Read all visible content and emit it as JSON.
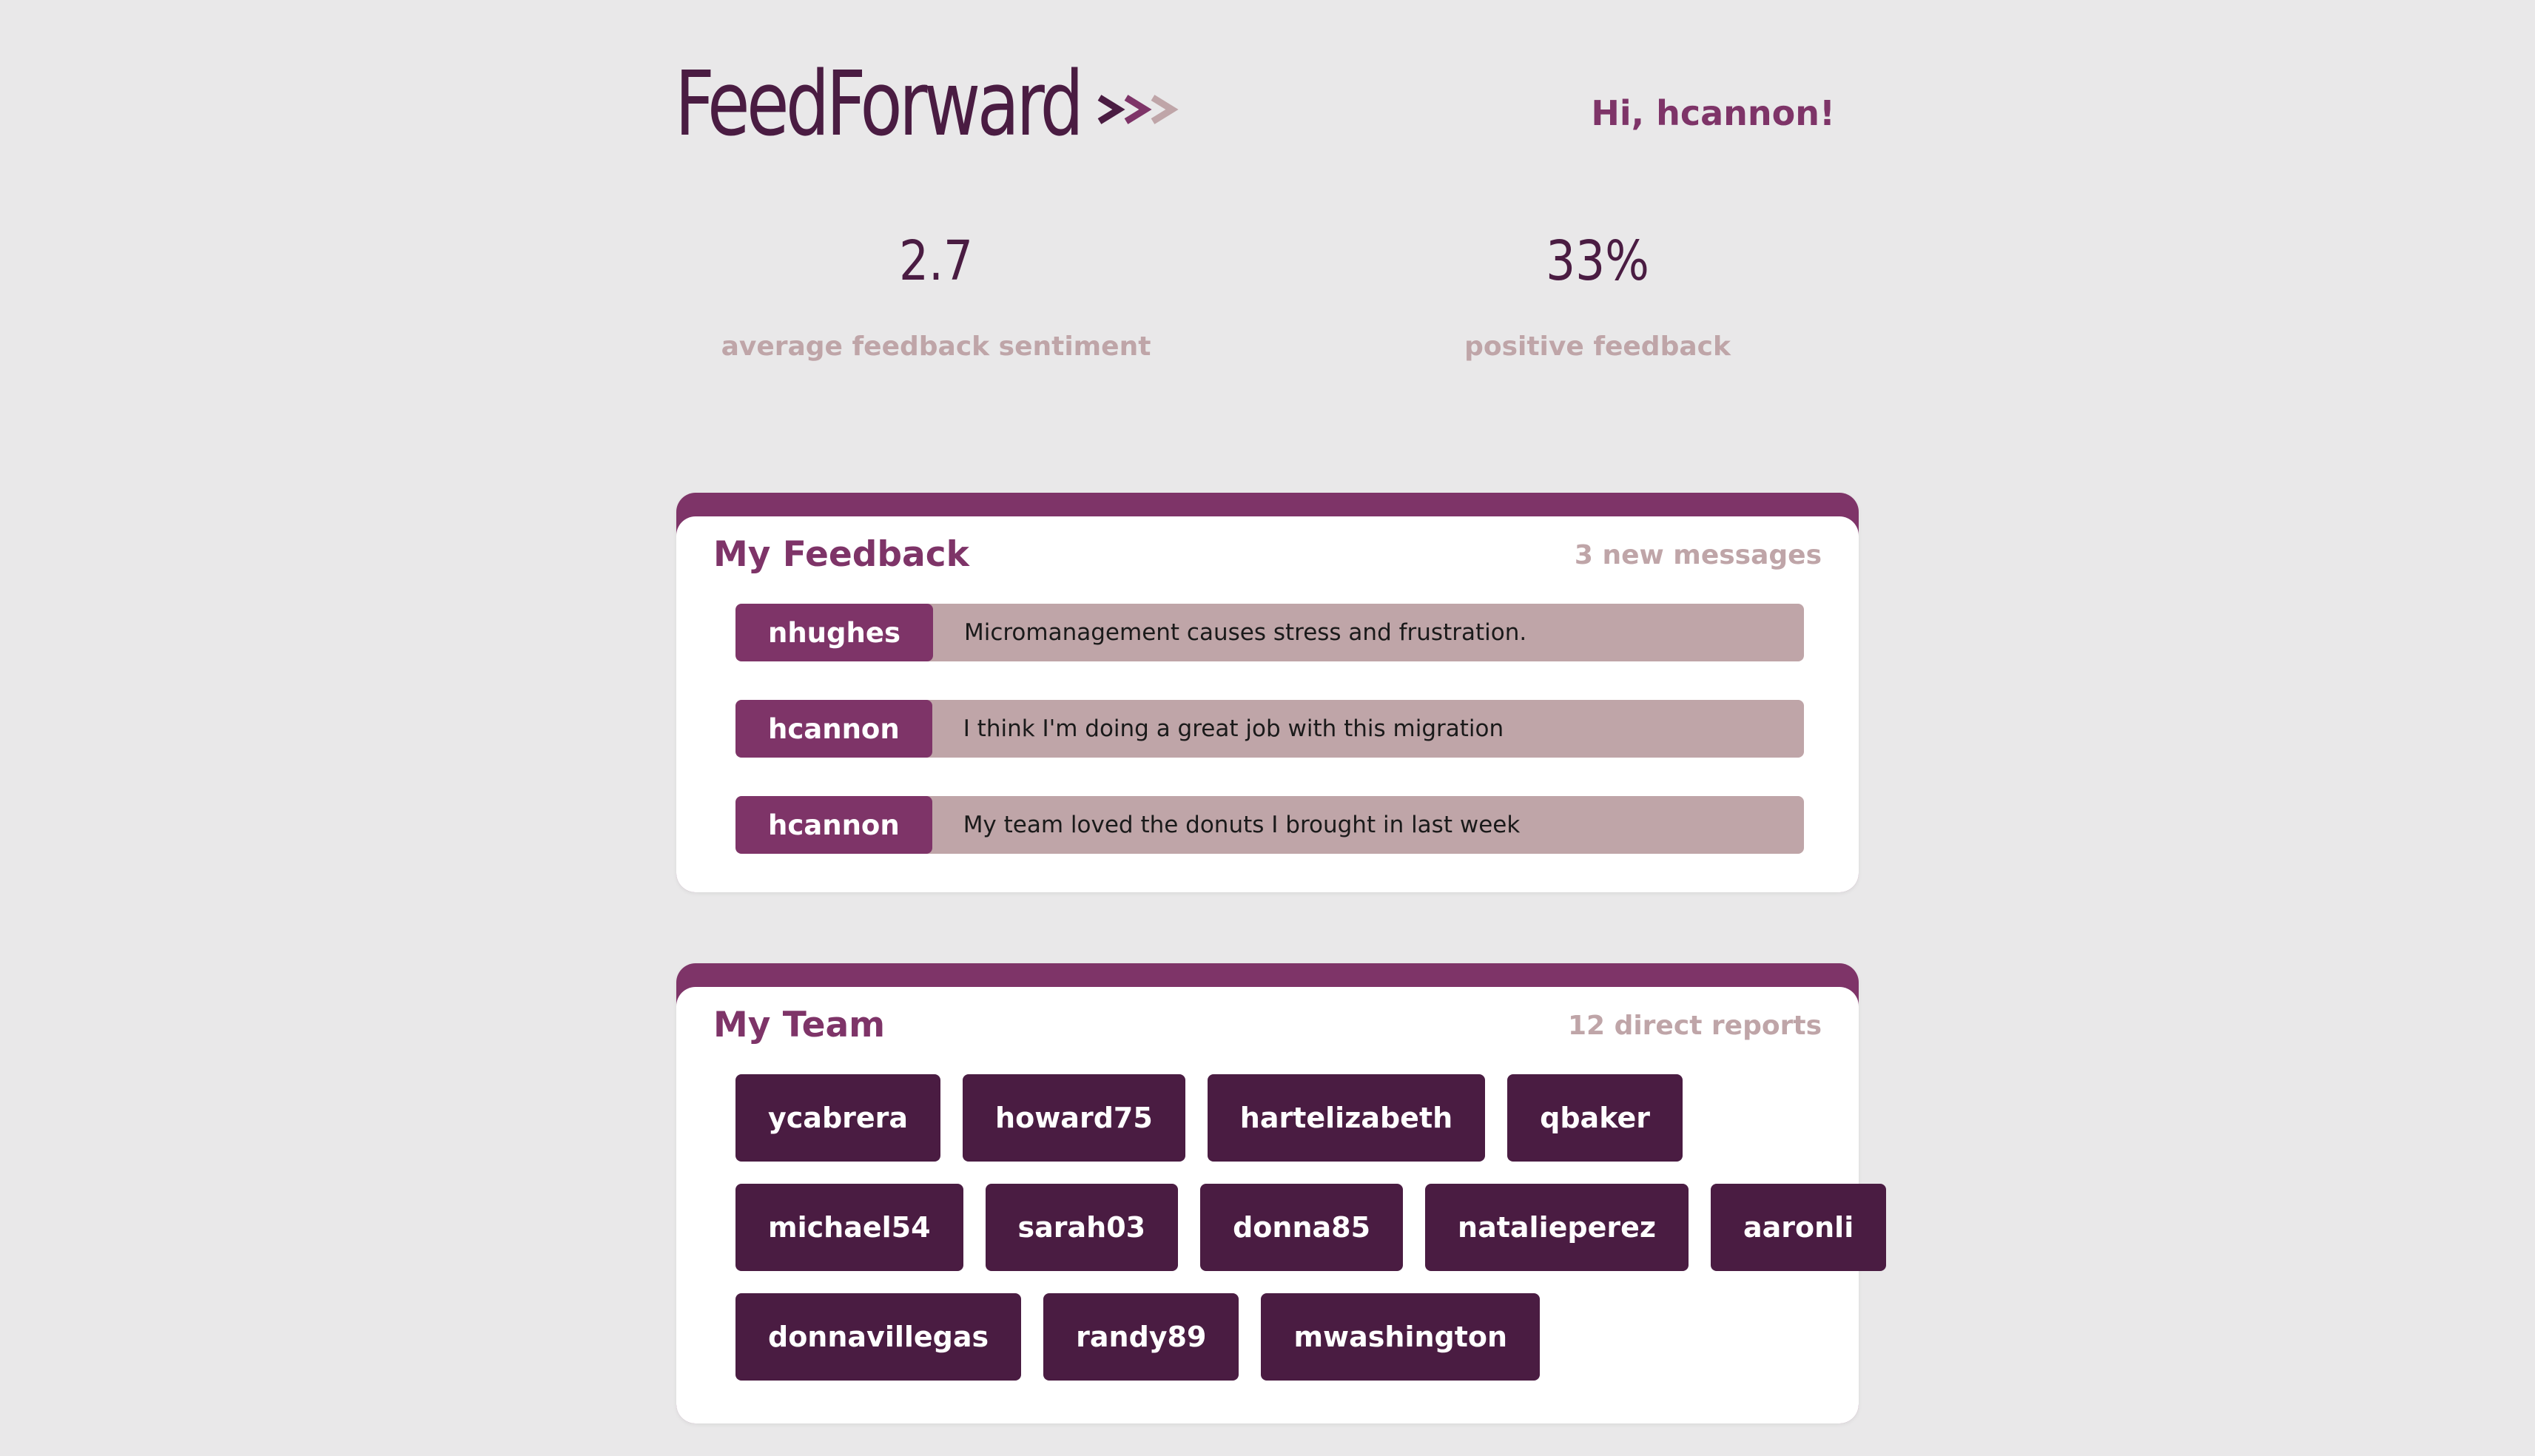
{
  "header": {
    "brand": "FeedForward",
    "greeting": "Hi, hcannon!"
  },
  "colors": {
    "primary": "#7e3468",
    "dark": "#4a1c42",
    "muted": "#bfa5a8",
    "background": "#e9e8e9"
  },
  "stats": {
    "sentiment": {
      "value": "2.7",
      "label": "average feedback sentiment"
    },
    "positive": {
      "value": "33%",
      "label": "positive feedback"
    }
  },
  "feedback": {
    "title": "My Feedback",
    "meta": "3 new messages",
    "items": [
      {
        "author": "nhughes",
        "text": "Micromanagement causes stress and frustration."
      },
      {
        "author": "hcannon",
        "text": "I think I'm doing a great job with this migration"
      },
      {
        "author": "hcannon",
        "text": "My team loved the donuts I brought in last week"
      }
    ]
  },
  "team": {
    "title": "My Team",
    "meta": "12 direct reports",
    "rows": [
      [
        "ycabrera",
        "howard75",
        "hartelizabeth",
        "qbaker"
      ],
      [
        "michael54",
        "sarah03",
        "donna85",
        "natalieperez",
        "aaronli"
      ],
      [
        "donnavillegas",
        "randy89",
        "mwashington"
      ]
    ]
  }
}
